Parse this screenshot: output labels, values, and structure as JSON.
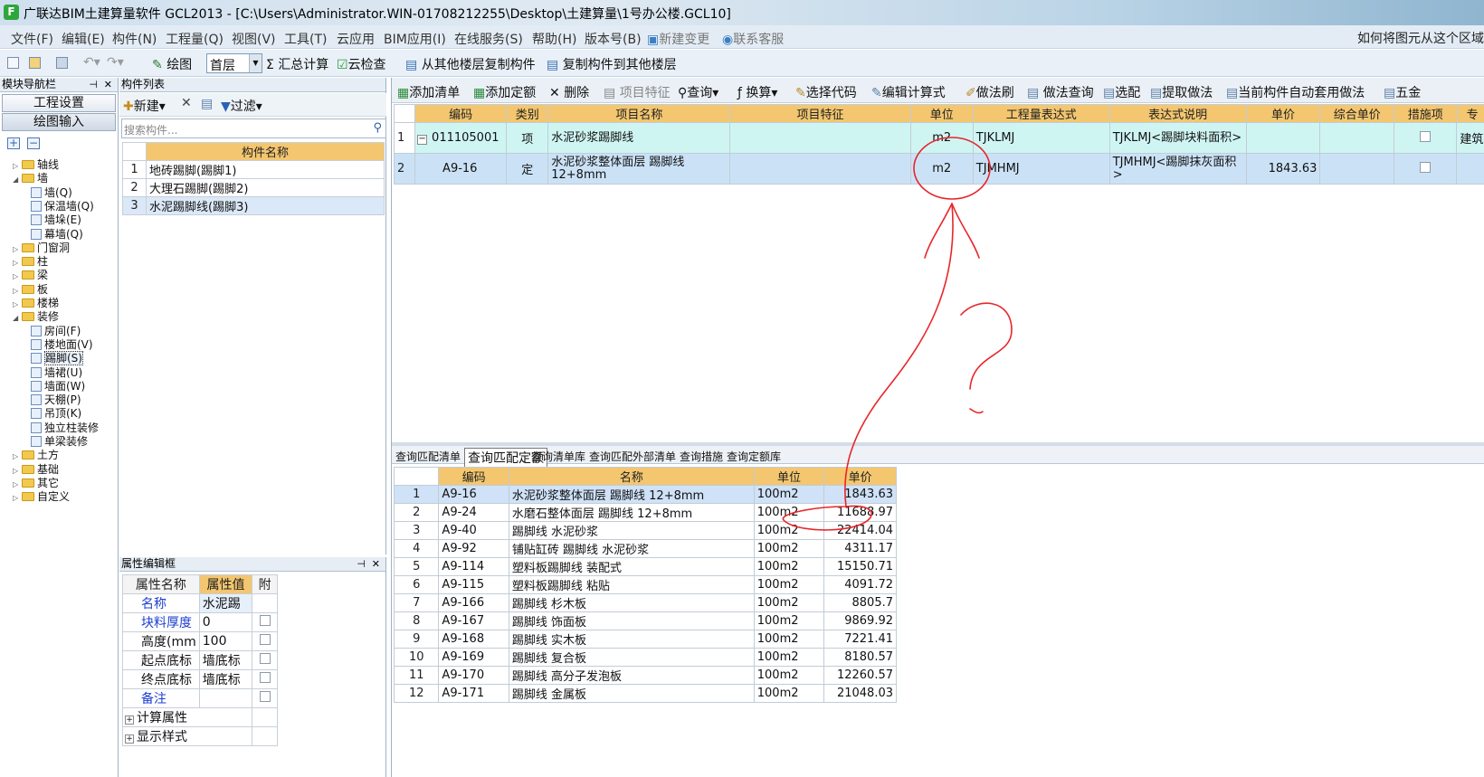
{
  "window": {
    "app_icon": "F",
    "title": "广联达BIM土建算量软件 GCL2013 - [C:\\Users\\Administrator.WIN-01708212255\\Desktop\\土建算量\\1号办公楼.GCL10]"
  },
  "menu": {
    "items": [
      "文件(F)",
      "编辑(E)",
      "构件(N)",
      "工程量(Q)",
      "视图(V)",
      "工具(T)",
      "云应用",
      "BIM应用(I)",
      "在线服务(S)",
      "帮助(H)",
      "版本号(B)",
      "新建变更",
      "联系客服"
    ],
    "help_text": "如何将图元从这个区域"
  },
  "toolbar": {
    "draw_label": "绘图",
    "floor_value": "首层",
    "sum_label": "汇总计算",
    "cloud_check_label": "云检查",
    "copy_from_label": "从其他楼层复制构件",
    "copy_to_label": "复制构件到其他楼层"
  },
  "nav": {
    "header": "模块导航栏",
    "btn_project": "工程设置",
    "btn_draw": "绘图输入",
    "tree": [
      {
        "label": "轴线",
        "level": 0,
        "exp": "▷"
      },
      {
        "label": "墙",
        "level": 0,
        "exp": "◢"
      },
      {
        "label": "墙(Q)",
        "level": 1
      },
      {
        "label": "保温墙(Q)",
        "level": 1
      },
      {
        "label": "墙垛(E)",
        "level": 1
      },
      {
        "label": "幕墙(Q)",
        "level": 1
      },
      {
        "label": "门窗洞",
        "level": 0,
        "exp": "▷"
      },
      {
        "label": "柱",
        "level": 0,
        "exp": "▷"
      },
      {
        "label": "梁",
        "level": 0,
        "exp": "▷"
      },
      {
        "label": "板",
        "level": 0,
        "exp": "▷"
      },
      {
        "label": "楼梯",
        "level": 0,
        "exp": "▷"
      },
      {
        "label": "装修",
        "level": 0,
        "exp": "◢"
      },
      {
        "label": "房间(F)",
        "level": 1
      },
      {
        "label": "楼地面(V)",
        "level": 1
      },
      {
        "label": "踢脚(S)",
        "level": 1,
        "selected": true
      },
      {
        "label": "墙裙(U)",
        "level": 1
      },
      {
        "label": "墙面(W)",
        "level": 1
      },
      {
        "label": "天棚(P)",
        "level": 1
      },
      {
        "label": "吊顶(K)",
        "level": 1
      },
      {
        "label": "独立柱装修",
        "level": 1
      },
      {
        "label": "单梁装修",
        "level": 1
      },
      {
        "label": "土方",
        "level": 0,
        "exp": "▷"
      },
      {
        "label": "基础",
        "level": 0,
        "exp": "▷"
      },
      {
        "label": "其它",
        "level": 0,
        "exp": "▷"
      },
      {
        "label": "自定义",
        "level": 0,
        "exp": "▷"
      }
    ]
  },
  "complist": {
    "header": "构件列表",
    "new_label": "新建",
    "filter_label": "过滤",
    "search_placeholder": "搜索构件...",
    "column": "构件名称",
    "rows": [
      {
        "no": "1",
        "name": "地砖踢脚(踢脚1)"
      },
      {
        "no": "2",
        "name": "大理石踢脚(踢脚2)"
      },
      {
        "no": "3",
        "name": "水泥踢脚线(踢脚3)"
      }
    ]
  },
  "props": {
    "header": "属性编辑框",
    "col_name": "属性名称",
    "col_value": "属性值",
    "col_attach": "附",
    "rows": [
      {
        "name": "名称",
        "value": "水泥踢",
        "blue": true
      },
      {
        "name": "块料厚度",
        "value": "0",
        "blue": true
      },
      {
        "name": "高度(mm",
        "value": "100",
        "blue": false
      },
      {
        "name": "起点底标",
        "value": "墙底标",
        "blue": false
      },
      {
        "name": "终点底标",
        "value": "墙底标",
        "blue": false
      },
      {
        "name": "备注",
        "value": "",
        "blue": true
      },
      {
        "name": "计算属性",
        "value": "",
        "group": true
      },
      {
        "name": "显示样式",
        "value": "",
        "group": true
      }
    ]
  },
  "listbar": {
    "add_list": "添加清单",
    "add_quota": "添加定额",
    "delete": "删除",
    "item_feature": "项目特征",
    "query": "查询",
    "convert": "换算",
    "select_code": "选择代码",
    "edit_formula": "编辑计算式",
    "brush": "做法刷",
    "method_query": "做法查询",
    "pick": "选配",
    "extract": "提取做法",
    "auto_apply": "当前构件自动套用做法",
    "five": "五金"
  },
  "upper": {
    "columns": [
      "编码",
      "类别",
      "项目名称",
      "项目特征",
      "单位",
      "工程量表达式",
      "表达式说明",
      "单价",
      "综合单价",
      "措施项",
      "专"
    ],
    "rows": [
      {
        "no": "1",
        "code": "011105001",
        "type": "项",
        "name": "水泥砂浆踢脚线",
        "feature": "",
        "unit": "m2",
        "expr": "TJKLMJ",
        "desc": "TJKLMJ<踢脚块料面积>",
        "price": "",
        "total": "",
        "spec": "建筑"
      },
      {
        "no": "2",
        "code": "A9-16",
        "type": "定",
        "name": "水泥砂浆整体面层 踢脚线 12+8mm",
        "feature": "",
        "unit": "m2",
        "expr": "TJMHMJ",
        "desc": "TJMHMJ<踢脚抹灰面积>",
        "price": "1843.63",
        "total": "",
        "spec": ""
      }
    ]
  },
  "lower": {
    "tabs": [
      "查询匹配清单",
      "查询匹配定额",
      "查询清单库",
      "查询匹配外部清单",
      "查询措施",
      "查询定额库"
    ],
    "active_tab": "查询匹配定额",
    "columns": [
      "编码",
      "名称",
      "单位",
      "单价"
    ],
    "rows": [
      {
        "no": "1",
        "code": "A9-16",
        "name": "水泥砂浆整体面层 踢脚线 12+8mm",
        "unit": "100m2",
        "price": "1843.63"
      },
      {
        "no": "2",
        "code": "A9-24",
        "name": "水磨石整体面层 踢脚线 12+8mm",
        "unit": "100m2",
        "price": "11688.97"
      },
      {
        "no": "3",
        "code": "A9-40",
        "name": "踢脚线 水泥砂浆",
        "unit": "100m2",
        "price": "22414.04"
      },
      {
        "no": "4",
        "code": "A9-92",
        "name": "铺贴缸砖 踢脚线 水泥砂浆",
        "unit": "100m2",
        "price": "4311.17"
      },
      {
        "no": "5",
        "code": "A9-114",
        "name": "塑料板踢脚线 装配式",
        "unit": "100m2",
        "price": "15150.71"
      },
      {
        "no": "6",
        "code": "A9-115",
        "name": "塑料板踢脚线 粘贴",
        "unit": "100m2",
        "price": "4091.72"
      },
      {
        "no": "7",
        "code": "A9-166",
        "name": "踢脚线 杉木板",
        "unit": "100m2",
        "price": "8805.7"
      },
      {
        "no": "8",
        "code": "A9-167",
        "name": "踢脚线 饰面板",
        "unit": "100m2",
        "price": "9869.92"
      },
      {
        "no": "9",
        "code": "A9-168",
        "name": "踢脚线 实木板",
        "unit": "100m2",
        "price": "7221.41"
      },
      {
        "no": "10",
        "code": "A9-169",
        "name": "踢脚线 复合板",
        "unit": "100m2",
        "price": "8180.57"
      },
      {
        "no": "11",
        "code": "A9-170",
        "name": "踢脚线 高分子发泡板",
        "unit": "100m2",
        "price": "12260.57"
      },
      {
        "no": "12",
        "code": "A9-171",
        "name": "踢脚线 金属板",
        "unit": "100m2",
        "price": "21048.03"
      }
    ]
  },
  "annotation_color": "#e8262a"
}
